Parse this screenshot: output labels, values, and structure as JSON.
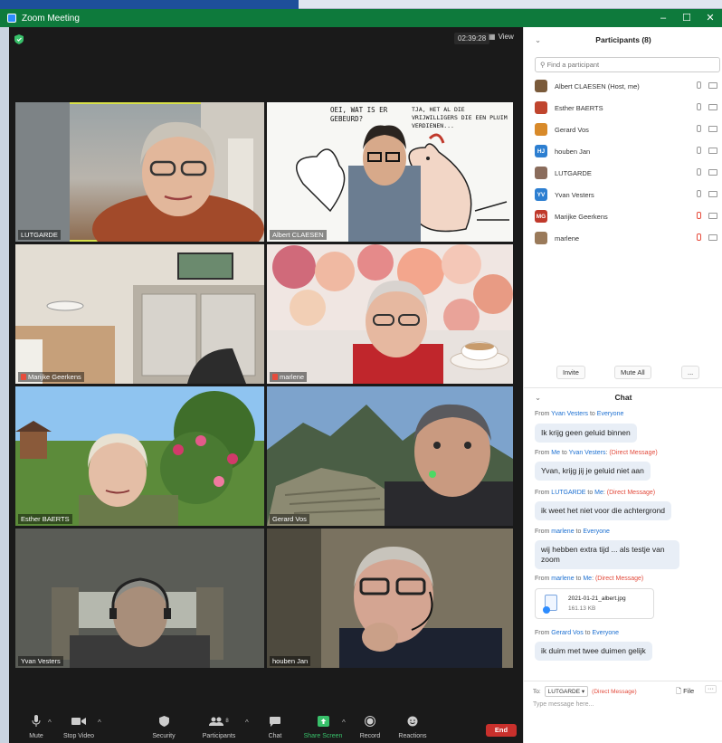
{
  "window": {
    "title": "Zoom Meeting",
    "controls": [
      "–",
      "☐",
      "✕"
    ]
  },
  "meeting": {
    "timer": "02:39:28",
    "view_label": "View",
    "tiles": [
      {
        "name": "LUTGARDE",
        "muted": false,
        "active": true
      },
      {
        "name": "Albert CLAESEN",
        "muted": false,
        "active": false
      },
      {
        "name": "Marijke Geerkens",
        "muted": true,
        "active": false
      },
      {
        "name": "marlene",
        "muted": true,
        "active": false
      },
      {
        "name": "Esther BAERTS",
        "muted": false,
        "active": false
      },
      {
        "name": "Gerard Vos",
        "muted": false,
        "active": false
      },
      {
        "name": "Yvan Vesters",
        "muted": false,
        "active": false
      },
      {
        "name": "houben Jan",
        "muted": false,
        "active": false
      }
    ],
    "cartoon_text": {
      "left": "OEI, WAT IS ER GEBEURD?",
      "right": "TJA, HET AL DIE VRIJWILLIGERS DIE EEN PLUIM VERDIENEN..."
    }
  },
  "toolbar": {
    "mute": "Mute",
    "stop_video": "Stop Video",
    "security": "Security",
    "participants": "Participants",
    "participants_count": "8",
    "chat": "Chat",
    "share_screen": "Share Screen",
    "record": "Record",
    "reactions": "Reactions",
    "end": "End"
  },
  "participants": {
    "header": "Participants (8)",
    "search_placeholder": "Find a participant",
    "list": [
      {
        "name": "Albert CLAESEN (Host, me)",
        "avatar": "",
        "color": "#7a5a3a",
        "muted": false
      },
      {
        "name": "Esther BAERTS",
        "avatar": "",
        "color": "#c0452e",
        "muted": false
      },
      {
        "name": "Gerard Vos",
        "avatar": "",
        "color": "#d88a2a",
        "muted": false
      },
      {
        "name": "houben Jan",
        "avatar": "HJ",
        "color": "#2d7fd1",
        "muted": false
      },
      {
        "name": "LUTGARDE",
        "avatar": "",
        "color": "#8a6c5c",
        "muted": false
      },
      {
        "name": "Yvan Vesters",
        "avatar": "YV",
        "color": "#2d7fd1",
        "muted": false
      },
      {
        "name": "Marijke Geerkens",
        "avatar": "MG",
        "color": "#c0392b",
        "muted": true
      },
      {
        "name": "marlene",
        "avatar": "",
        "color": "#9a7a5a",
        "muted": true
      }
    ],
    "invite": "Invite",
    "mute_all": "Mute All",
    "more": "..."
  },
  "chat": {
    "header": "Chat",
    "messages": [
      {
        "from": "Yvan Vesters",
        "to": "Everyone",
        "dm": "",
        "text": "Ik krijg geen geluid binnen"
      },
      {
        "from": "Me",
        "to": "Yvan Vesters",
        "dm": "(Direct Message)",
        "text": "Yvan, krijg jij je geluid niet aan"
      },
      {
        "from": "LUTGARDE",
        "to": "Me",
        "dm": "(Direct Message)",
        "text": "ik weet het niet voor die achtergrond"
      },
      {
        "from": "marlene",
        "to": "Everyone",
        "dm": "",
        "text": "wij hebben extra tijd ... als testje van zoom"
      },
      {
        "from": "marlene",
        "to": "Me",
        "dm": "(Direct Message)",
        "file_name": "2021-01-21_albert.jpg",
        "file_size": "161.13 KB"
      },
      {
        "from": "Gerard Vos",
        "to": "Everyone",
        "dm": "",
        "text": "ik duim met twee duimen gelijk"
      }
    ],
    "words": {
      "from": "From",
      "to": "to"
    },
    "to_label": "To:",
    "to_selected": "LUTGARDE",
    "to_dm": "(Direct Message)",
    "file_button": "File",
    "more": "···",
    "placeholder": "Type message here..."
  },
  "colors": {
    "title_green": "#0e7a3c",
    "meeting_bg": "#1a1a1a",
    "end_red": "#c9302c",
    "link_blue": "#1b6fd1",
    "dm_red": "#e24a3b"
  }
}
